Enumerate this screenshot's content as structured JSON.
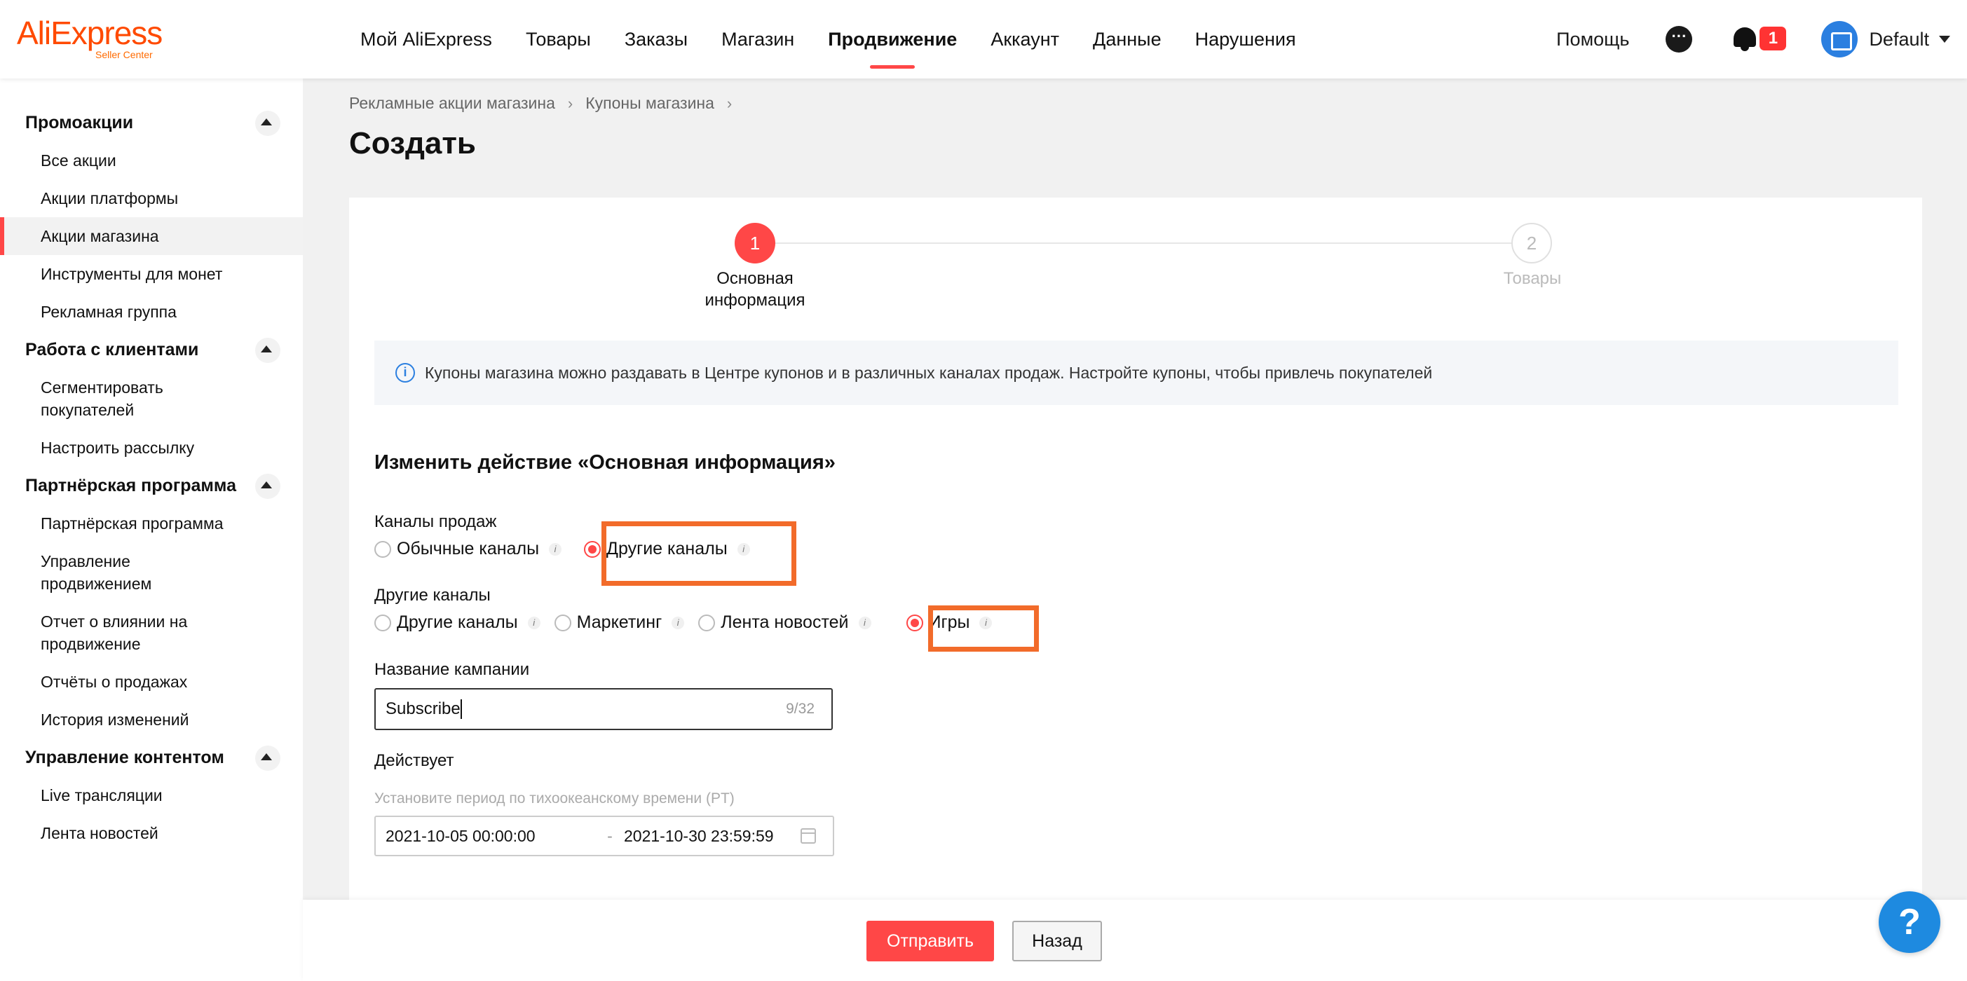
{
  "header": {
    "logo_text": "AliExpress",
    "logo_sub": "Seller Center",
    "nav": [
      "Мой AliExpress",
      "Товары",
      "Заказы",
      "Магазин",
      "Продвижение",
      "Аккаунт",
      "Данные",
      "Нарушения"
    ],
    "active_nav": "Продвижение",
    "help_label": "Помощь",
    "notification_count": "1",
    "account_name": "Default"
  },
  "sidebar": {
    "groups": [
      {
        "title": "Промоакции",
        "items": [
          "Все акции",
          "Акции платформы",
          "Акции магазина",
          "Инструменты для монет",
          "Рекламная группа"
        ]
      },
      {
        "title": "Работа с клиентами",
        "items": [
          "Сегментировать покупателей",
          "Настроить рассылку"
        ]
      },
      {
        "title": "Партнёрская программа",
        "items": [
          "Партнёрская программа",
          "Управление продвижением",
          "Отчет о влиянии на продвижение",
          "Отчёты о продажах",
          "История изменений"
        ]
      },
      {
        "title": "Управление контентом",
        "items": [
          "Live трансляции",
          "Лента новостей"
        ]
      }
    ],
    "active_item": "Акции магазина"
  },
  "breadcrumb": [
    "Рекламные акции магазина",
    "Купоны магазина"
  ],
  "page_title": "Создать",
  "steps": [
    {
      "number": "1",
      "label": "Основная информация"
    },
    {
      "number": "2",
      "label": "Товары"
    }
  ],
  "info_banner": "Купоны магазина можно раздавать в Центре купонов и в различных каналах продаж. Настройте купоны, чтобы привлечь покупателей",
  "form": {
    "section_title": "Изменить действие «Основная информация»",
    "sales_channels_label": "Каналы продаж",
    "sales_channels": [
      "Обычные каналы",
      "Другие каналы"
    ],
    "sales_channel_selected": "Другие каналы",
    "other_channels_label": "Другие каналы",
    "other_channels": [
      "Другие каналы",
      "Маркетинг",
      "Лента новостей",
      "Игры"
    ],
    "other_channel_selected": "Игры",
    "campaign_name_label": "Название кампании",
    "campaign_name_value": "Subscribe",
    "campaign_name_count": "9/32",
    "valid_label": "Действует",
    "valid_hint": "Установите период по тихоокеанскому времени (PT)",
    "date_start": "2021-10-05 00:00:00",
    "date_end": "2021-10-30 23:59:59"
  },
  "footer": {
    "submit_label": "Отправить",
    "back_label": "Назад"
  },
  "colors": {
    "accent": "#ff4747",
    "highlight": "#f26b2a",
    "info_blue": "#2b7fe0"
  }
}
